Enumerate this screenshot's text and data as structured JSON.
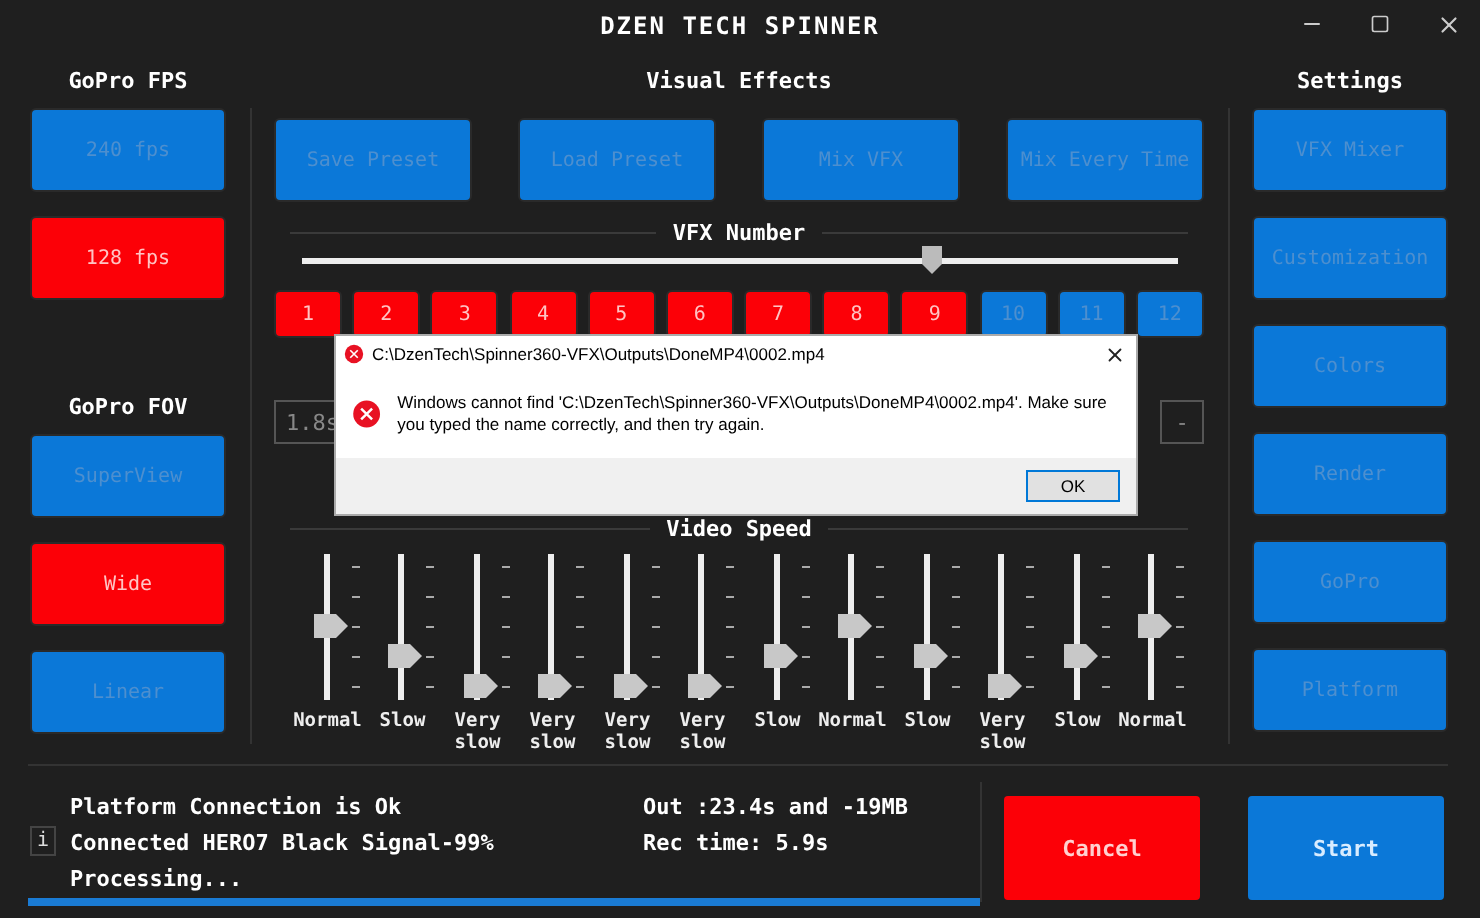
{
  "window": {
    "title": "DZEN TECH SPINNER"
  },
  "fps": {
    "title": "GoPro FPS",
    "buttons": [
      {
        "label": "240 fps",
        "selected": false,
        "disabled": true
      },
      {
        "label": "128 fps",
        "selected": true,
        "disabled": true
      }
    ]
  },
  "fov": {
    "title": "GoPro FOV",
    "buttons": [
      {
        "label": "SuperView",
        "selected": false,
        "disabled": true
      },
      {
        "label": "Wide",
        "selected": true,
        "disabled": true
      },
      {
        "label": "Linear",
        "selected": false,
        "disabled": true
      }
    ]
  },
  "effects": {
    "title": "Visual Effects",
    "buttons": [
      {
        "label": "Save Preset",
        "disabled": true
      },
      {
        "label": "Load Preset",
        "disabled": true
      },
      {
        "label": "Mix VFX",
        "disabled": true
      },
      {
        "label": "Mix Every Time",
        "disabled": true
      }
    ]
  },
  "vfx_number": {
    "title": "VFX Number",
    "level": 0.72,
    "buttons": [
      {
        "label": "1",
        "selected": true
      },
      {
        "label": "2",
        "selected": true
      },
      {
        "label": "3",
        "selected": true
      },
      {
        "label": "4",
        "selected": true
      },
      {
        "label": "5",
        "selected": true
      },
      {
        "label": "6",
        "selected": true
      },
      {
        "label": "7",
        "selected": true
      },
      {
        "label": "8",
        "selected": true
      },
      {
        "label": "9",
        "selected": true
      },
      {
        "label": "10",
        "selected": false
      },
      {
        "label": "11",
        "selected": false
      },
      {
        "label": "12",
        "selected": false
      }
    ]
  },
  "duration_field": {
    "value": "1.8s"
  },
  "step_button": {
    "label": "-"
  },
  "video_speed": {
    "title": "Video Speed",
    "sliders": [
      {
        "label": "Normal",
        "level": 0.5
      },
      {
        "label": "Slow",
        "level": 0.25
      },
      {
        "label": "Very slow",
        "level": 0
      },
      {
        "label": "Very slow",
        "level": 0
      },
      {
        "label": "Very slow",
        "level": 0
      },
      {
        "label": "Very slow",
        "level": 0
      },
      {
        "label": "Slow",
        "level": 0.25
      },
      {
        "label": "Normal",
        "level": 0.5
      },
      {
        "label": "Slow",
        "level": 0.25
      },
      {
        "label": "Very slow",
        "level": 0
      },
      {
        "label": "Slow",
        "level": 0.25
      },
      {
        "label": "Normal",
        "level": 0.5
      }
    ]
  },
  "settings": {
    "title": "Settings",
    "buttons": [
      {
        "label": "VFX Mixer",
        "disabled": true
      },
      {
        "label": "Customization",
        "disabled": true
      },
      {
        "label": "Colors",
        "disabled": true
      },
      {
        "label": "Render",
        "disabled": true
      },
      {
        "label": "GoPro",
        "disabled": true
      },
      {
        "label": "Platform",
        "disabled": true
      }
    ]
  },
  "status": {
    "info_icon": "i",
    "lines": [
      "Platform Connection is Ok",
      "Connected HERO7 Black Signal-99%",
      "Processing..."
    ],
    "output": [
      "Out :23.4s and -19MB",
      "Rec time: 5.9s"
    ],
    "progress": {
      "level": 1
    }
  },
  "actions": [
    {
      "label": "Cancel",
      "kind": "danger"
    },
    {
      "label": "Start",
      "kind": "primary"
    }
  ],
  "dialog": {
    "title": "C:\\DzenTech\\Spinner360-VFX\\Outputs\\DoneMP4\\0002.mp4",
    "message": "Windows cannot find 'C:\\DzenTech\\Spinner360-VFX\\Outputs\\DoneMP4\\0002.mp4'. Make sure you typed the name correctly, and then try again.",
    "button": "OK"
  }
}
